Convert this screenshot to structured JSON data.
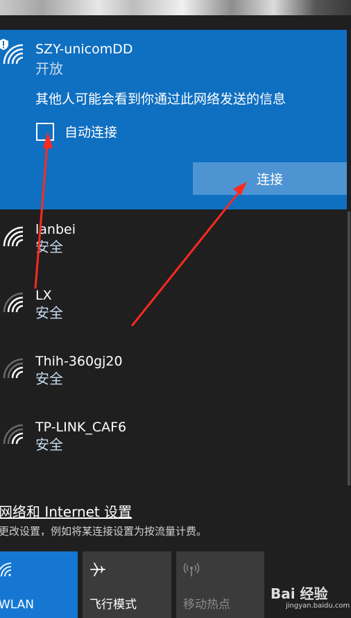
{
  "selected_network": {
    "name": "SZY-unicomDD",
    "status": "开放",
    "warning": "其他人可能会看到你通过此网络发送的信息",
    "auto_connect_label": "自动连接",
    "auto_connect_checked": false,
    "connect_label": "连接"
  },
  "networks": [
    {
      "name": "lanbei",
      "status": "安全"
    },
    {
      "name": "LX",
      "status": "安全"
    },
    {
      "name": "Thih-360gj20",
      "status": "安全"
    },
    {
      "name": "TP-LINK_CAF6",
      "status": "安全"
    }
  ],
  "settings": {
    "link": "网络和 Internet 设置",
    "description": "更改设置，例如将某连接设置为按流量计费。"
  },
  "quick_actions": [
    {
      "label": "WLAN",
      "icon": "wifi-icon",
      "active": true
    },
    {
      "label": "飞行模式",
      "icon": "airplane-icon",
      "active": false
    },
    {
      "label": "移动热点",
      "icon": "hotspot-icon",
      "active": false,
      "disabled": true
    }
  ],
  "watermark": {
    "main": "Bai 经验",
    "sub": "jingyan.baidu.com"
  },
  "colors": {
    "selected_bg": "#0f6fc1",
    "connect_button": "#4e94d3",
    "panel_bg": "#1f1f1f",
    "tile_active": "#1677d2",
    "tile_inactive": "#3b3b3b",
    "annotation_arrow": "#ff2a1f"
  }
}
